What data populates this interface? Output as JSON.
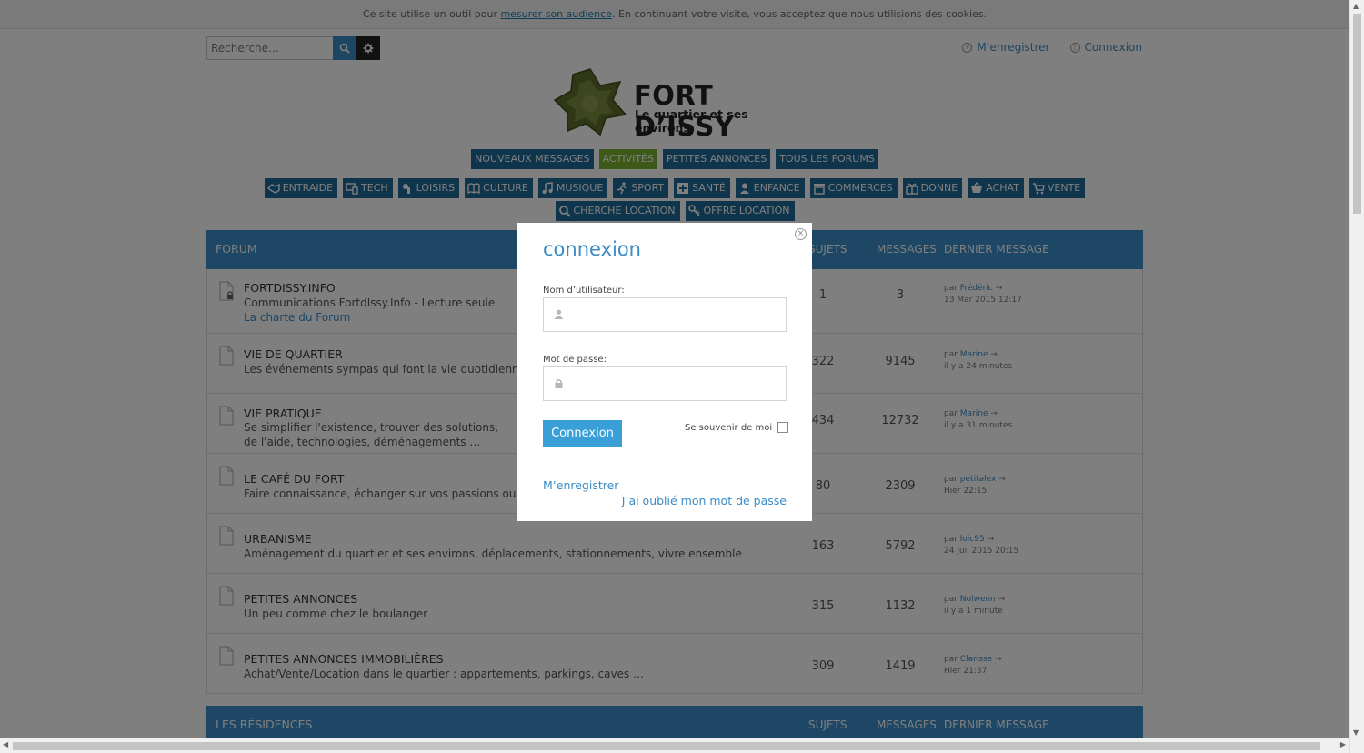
{
  "cookie": {
    "before": "Ce site utilise un outil pour ",
    "link": "mesurer son audience",
    "after": ". En continuant votre visite, vous acceptez que nous utilisions des cookies."
  },
  "search": {
    "placeholder": "Recherche…"
  },
  "header_links": {
    "register": "M’enregistrer",
    "login": "Connexion"
  },
  "logo": {
    "title": "FORT D’ISSY",
    "subtitle": "Le quartier et ses environs"
  },
  "nav_primary": [
    {
      "label": "NOUVEAUX MESSAGES",
      "active": false
    },
    {
      "label": "ACTIVITÉS",
      "active": true
    },
    {
      "label": "PETITES ANNONCES",
      "active": false
    },
    {
      "label": "TOUS LES FORUMS",
      "active": false
    }
  ],
  "nav_categories_row1": [
    {
      "label": "ENTRAIDE",
      "icon": "handshake-icon"
    },
    {
      "label": "TECH",
      "icon": "devices-icon"
    },
    {
      "label": "LOISIRS",
      "icon": "leisure-icon"
    },
    {
      "label": "CULTURE",
      "icon": "book-icon"
    },
    {
      "label": "MUSIQUE",
      "icon": "music-note-icon"
    },
    {
      "label": "SPORT",
      "icon": "running-icon"
    },
    {
      "label": "SANTÉ",
      "icon": "medical-cross-icon"
    },
    {
      "label": "ENFANCE",
      "icon": "child-icon"
    },
    {
      "label": "COMMERCES",
      "icon": "shop-icon"
    },
    {
      "label": "DONNE",
      "icon": "gift-icon"
    },
    {
      "label": "ACHAT",
      "icon": "basket-icon"
    },
    {
      "label": "VENTE",
      "icon": "cart-icon"
    }
  ],
  "nav_categories_row2": [
    {
      "label": "CHERCHE LOCATION",
      "icon": "search-icon"
    },
    {
      "label": "OFFRE LOCATION",
      "icon": "key-icon"
    }
  ],
  "forum_header": {
    "forum": "FORUM",
    "topics": "SUJETS",
    "messages": "MESSAGES",
    "last": "DERNIER MESSAGE"
  },
  "forums": [
    {
      "name": "FORTDISSY.INFO",
      "desc": "Communications FortdIssy.Info - Lecture seule",
      "link": "La charte du Forum",
      "locked": true,
      "topics": "1",
      "messages": "3",
      "last_by": "par ",
      "last_user": "Frédéric",
      "last_time": "13 Mar 2015 12:17"
    },
    {
      "name": "VIE DE QUARTIER",
      "desc": "Les événements sympas qui font la vie quotidienne au fort",
      "topics": "322",
      "messages": "9145",
      "last_by": "par ",
      "last_user": "Marine",
      "last_time": "il y a 24 minutes"
    },
    {
      "name": "VIE PRATIQUE",
      "desc": "Se simplifier l'existence, trouver des solutions, de l'aide, technologies, déménagements …",
      "topics": "434",
      "messages": "12732",
      "last_by": "par ",
      "last_user": "Marine",
      "last_time": "il y a 31 minutes"
    },
    {
      "name": "LE CAFÉ DU FORT",
      "desc": "Faire connaissance, échanger sur vos passions ou vos projets",
      "topics": "80",
      "messages": "2309",
      "last_by": "par ",
      "last_user": "petitalex",
      "last_time": "Hier 22:15"
    },
    {
      "name": "URBANISME",
      "desc": "Aménagement du quartier et ses environs, déplacements, stationnements, vivre ensemble",
      "topics": "163",
      "messages": "5792",
      "last_by": "par ",
      "last_user": "loic95",
      "last_time": "24 Juil 2015 20:15"
    },
    {
      "name": "PETITES ANNONCES",
      "desc": "Un peu comme chez le boulanger",
      "topics": "315",
      "messages": "1132",
      "last_by": "par ",
      "last_user": "Nolwenn",
      "last_time": "il y a 1 minute"
    },
    {
      "name": "PETITES ANNONCES IMMOBILIÈRES",
      "desc": "Achat/Vente/Location dans le quartier : appartements, parkings, caves …",
      "topics": "309",
      "messages": "1419",
      "last_by": "par ",
      "last_user": "Clarisse",
      "last_time": "Hier 21:37"
    }
  ],
  "residences_header": {
    "title": "LES RÉSIDENCES",
    "topics": "SUJETS",
    "messages": "MESSAGES",
    "last": "DERNIER MESSAGE"
  },
  "modal": {
    "title": "connexion",
    "close": "×",
    "username_label": "Nom d’utilisateur:",
    "password_label": "Mot de passe:",
    "submit": "Connexion",
    "remember": "Se souvenir de moi",
    "register": "M’enregistrer",
    "forgot": "J’ai oublié mon mot de passe"
  },
  "colors": {
    "primary": "#1e6a9b",
    "header_blue": "#3b8ec8",
    "active_green": "#7bb32e",
    "link_blue": "#3a8cc7",
    "button_blue": "#3a9fd6"
  }
}
